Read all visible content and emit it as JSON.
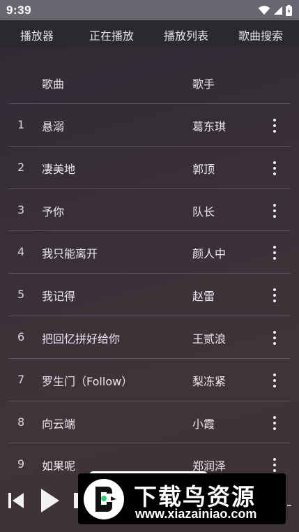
{
  "status_bar": {
    "time": "9:39",
    "icons": [
      "wifi-icon",
      "signal-icon",
      "battery-icon"
    ]
  },
  "tabs": [
    {
      "label": "播放器"
    },
    {
      "label": "正在播放"
    },
    {
      "label": "播放列表"
    },
    {
      "label": "歌曲搜索"
    }
  ],
  "table": {
    "headers": {
      "song": "歌曲",
      "artist": "歌手"
    },
    "rows": [
      {
        "num": "1",
        "title": "悬溺",
        "artist": "葛东琪"
      },
      {
        "num": "2",
        "title": "凄美地",
        "artist": "郭顶"
      },
      {
        "num": "3",
        "title": "予你",
        "artist": "队长"
      },
      {
        "num": "4",
        "title": "我只能离开",
        "artist": "颜人中"
      },
      {
        "num": "5",
        "title": "我记得",
        "artist": "赵雷"
      },
      {
        "num": "6",
        "title": "把回忆拼好给你",
        "artist": "王贰浪"
      },
      {
        "num": "7",
        "title": "罗生门（Follow）",
        "artist": "梨冻紧"
      },
      {
        "num": "8",
        "title": "向云端",
        "artist": "小霞"
      },
      {
        "num": "9",
        "title": "如果呢",
        "artist": "郑润泽"
      }
    ],
    "row_action_icon": "more-vert-icon"
  },
  "player": {
    "controls": [
      "skip-previous-icon",
      "play-icon",
      "skip-next-icon"
    ]
  },
  "watermark": {
    "title": "下载鸟资源",
    "url": "www.xiazainiao.com",
    "logo": "bird-logo-icon"
  },
  "colors": {
    "status_bar": "#6a6670",
    "tab_bar": "#2c2830",
    "background_top": "#2f2a34",
    "background_bottom": "#3e3236",
    "divider": "#786f80",
    "text": "#ece8f0"
  }
}
